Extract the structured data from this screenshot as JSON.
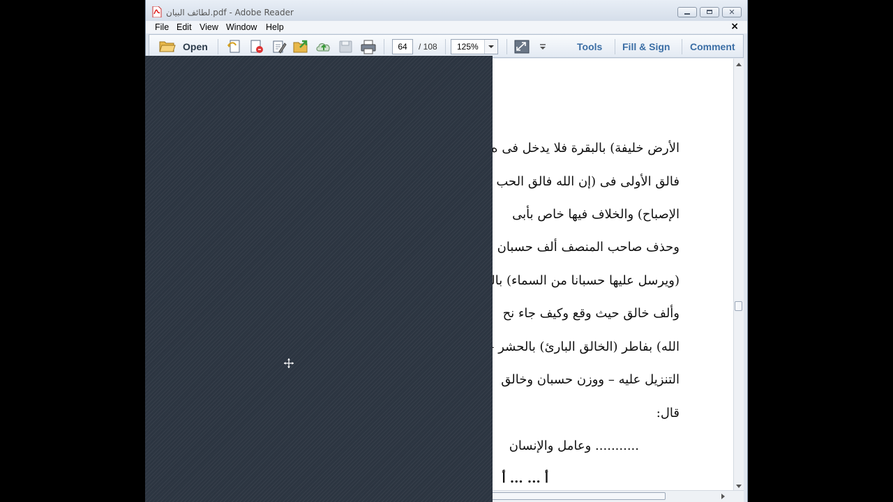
{
  "window": {
    "title": "لطائف البيان.pdf - Adobe Reader",
    "icon": "pdf-file-icon"
  },
  "menu": {
    "items": [
      "File",
      "Edit",
      "View",
      "Window",
      "Help"
    ],
    "close_glyph": "×"
  },
  "toolbar": {
    "open_label": "Open",
    "page_current": "64",
    "page_total": "/ 108",
    "zoom": "125%",
    "tools_label": "Tools",
    "fill_sign_label": "Fill & Sign",
    "comment_label": "Comment"
  },
  "document": {
    "lines": [
      "الأرض خليفة) بالبقرة فلا يدخل فى ه",
      "فالق الأولى فى (إن الله فالق الحب والن",
      "الإصباح) والخلاف فيها خاص بأبى",
      "وحذف صاحب المنصف ألف حسبان",
      "(ويرسل عليها حسبانا من السماء) بالك",
      "وألف خالق حيث وقع وكيف جاء نح",
      "الله) بفاطر (الخالق البارئ) بالحشر –",
      "التنزيل عليه – ووزن حسبان وخالق",
      "قال:",
      "........... وعامل والإنسان",
      "أ ... ... أ"
    ]
  },
  "colors": {
    "accent_link": "#3b6ea5",
    "overlay": "#2c3541"
  }
}
